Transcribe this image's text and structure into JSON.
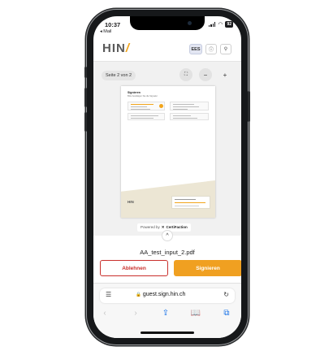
{
  "status": {
    "time": "10:37",
    "back_app": "◂ Mail",
    "battery": "92",
    "wifi_icon": "◠"
  },
  "header": {
    "logo_text": "HIN",
    "logo_slash": "/",
    "lang_button": "EES",
    "info_icon": "ⓘ",
    "user_icon": "⚲",
    "accent": "#f2a51c"
  },
  "viewer": {
    "page_label": "Seite 2 von 2",
    "zoom_fit_icon": "⛶",
    "zoom_out_icon": "−",
    "zoom_in_icon": "+",
    "document": {
      "title": "Signieren",
      "subtitle": "Bitte bestätigen Sie die Signatur"
    },
    "powered_by": "Powered by",
    "powered_mark": "✕",
    "powered_brand": "CertiFaction",
    "collapse_icon": "^"
  },
  "file": {
    "name": "AA_test_input_2.pdf"
  },
  "actions": {
    "decline_label": "Ablehnen",
    "sign_label": "Signieren",
    "decline_color": "#c9302c",
    "sign_color": "#f0a021"
  },
  "browser": {
    "menu_icon": "☰",
    "lock_icon": "🔒",
    "url": "guest.sign.hin.ch",
    "reload_icon": "↻",
    "back_icon": "‹",
    "forward_icon": "›",
    "share_icon": "⇪",
    "bookmarks_icon": "📖",
    "tabs_icon": "⧉"
  }
}
